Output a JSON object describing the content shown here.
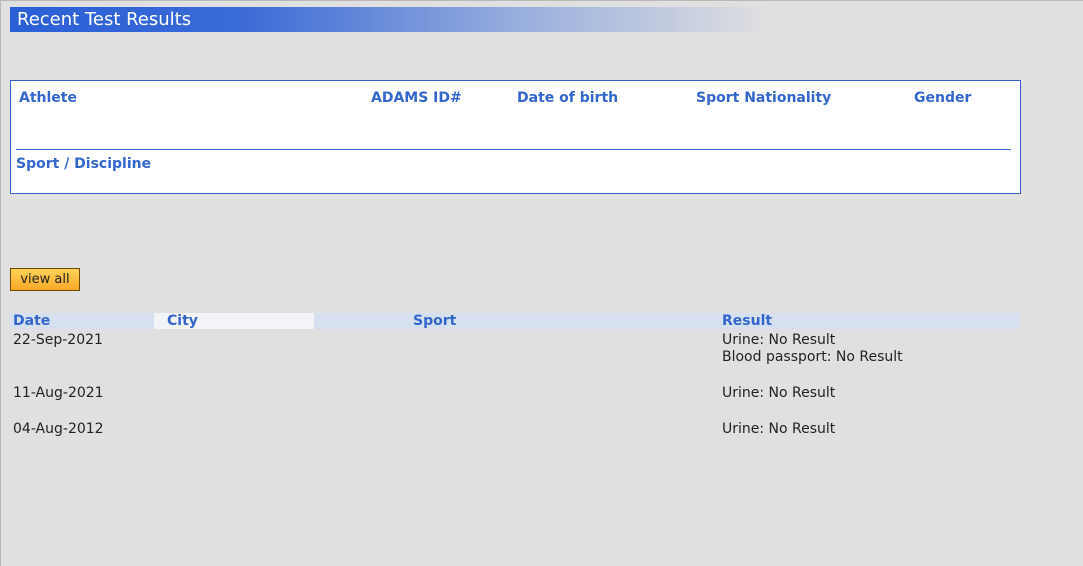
{
  "page": {
    "title": "Recent Test Results"
  },
  "athlete_info": {
    "athlete_label": "Athlete",
    "adams_id_label": "ADAMS ID#",
    "dob_label": "Date of birth",
    "sport_nationality_label": "Sport Nationality",
    "gender_label": "Gender",
    "sport_discipline_label": "Sport / Discipline"
  },
  "actions": {
    "view_all_label": "view all"
  },
  "results": {
    "columns": {
      "date": "Date",
      "city": "City",
      "sport": "Sport",
      "result": "Result"
    },
    "rows": [
      {
        "date": "22-Sep-2021",
        "results": [
          "Urine: No Result",
          "Blood passport: No Result"
        ]
      },
      {
        "date": "11-Aug-2021",
        "results": [
          "Urine: No Result"
        ]
      },
      {
        "date": "04-Aug-2012",
        "results": [
          "Urine: No Result"
        ]
      }
    ]
  },
  "colors": {
    "accent": "#3366cc",
    "title_bar": "#2a5fd6",
    "button": "#f8a826",
    "background": "#e0e0e0"
  }
}
